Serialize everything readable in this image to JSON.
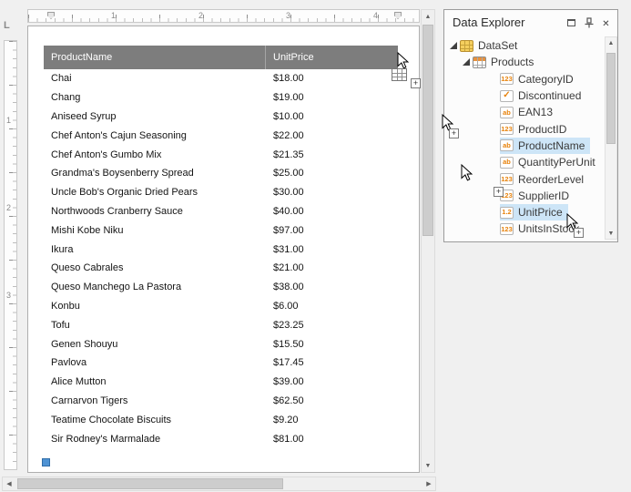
{
  "colors": {
    "accent_orange": "#e8830c",
    "table_header_bg": "#7d7d7d",
    "tree_selection_bg": "#cde5f7"
  },
  "design_surface": {
    "tab_stop": "L",
    "ruler_h_numbers": [
      "1",
      "2",
      "3",
      "4"
    ],
    "ruler_v_numbers": [
      "1",
      "2",
      "3"
    ],
    "table": {
      "columns": [
        "ProductName",
        "UnitPrice"
      ],
      "rows": [
        [
          "Chai",
          "$18.00"
        ],
        [
          "Chang",
          "$19.00"
        ],
        [
          "Aniseed Syrup",
          "$10.00"
        ],
        [
          "Chef Anton's Cajun Seasoning",
          "$22.00"
        ],
        [
          "Chef Anton's Gumbo Mix",
          "$21.35"
        ],
        [
          "Grandma's Boysenberry Spread",
          "$25.00"
        ],
        [
          "Uncle Bob's Organic Dried Pears",
          "$30.00"
        ],
        [
          "Northwoods Cranberry Sauce",
          "$40.00"
        ],
        [
          "Mishi Kobe Niku",
          "$97.00"
        ],
        [
          "Ikura",
          "$31.00"
        ],
        [
          "Queso Cabrales",
          "$21.00"
        ],
        [
          "Queso Manchego La Pastora",
          "$38.00"
        ],
        [
          "Konbu",
          "$6.00"
        ],
        [
          "Tofu",
          "$23.25"
        ],
        [
          "Genen Shouyu",
          "$15.50"
        ],
        [
          "Pavlova",
          "$17.45"
        ],
        [
          "Alice Mutton",
          "$39.00"
        ],
        [
          "Carnarvon Tigers",
          "$62.50"
        ],
        [
          "Teatime Chocolate Biscuits",
          "$9.20"
        ],
        [
          "Sir Rodney's Marmalade",
          "$81.00"
        ]
      ]
    }
  },
  "data_explorer": {
    "title": "Data Explorer",
    "icon_glyphs": {
      "int": "123",
      "string": "ab",
      "decimal": "1.2",
      "bool": "✓"
    },
    "tree": [
      {
        "label": "DataSet",
        "icon": "dataset",
        "level": 0,
        "expanded": true
      },
      {
        "label": "Products",
        "icon": "table",
        "level": 1,
        "expanded": true
      },
      {
        "label": "CategoryID",
        "icon": "int",
        "level": 2
      },
      {
        "label": "Discontinued",
        "icon": "bool",
        "level": 2
      },
      {
        "label": "EAN13",
        "icon": "string",
        "level": 2
      },
      {
        "label": "ProductID",
        "icon": "int",
        "level": 2
      },
      {
        "label": "ProductName",
        "icon": "string",
        "level": 2,
        "selected": true
      },
      {
        "label": "QuantityPerUnit",
        "icon": "string",
        "level": 2
      },
      {
        "label": "ReorderLevel",
        "icon": "int",
        "level": 2
      },
      {
        "label": "SupplierID",
        "icon": "int",
        "level": 2
      },
      {
        "label": "UnitPrice",
        "icon": "decimal",
        "level": 2,
        "selected": true
      },
      {
        "label": "UnitsInStock",
        "icon": "int",
        "level": 2
      }
    ]
  }
}
